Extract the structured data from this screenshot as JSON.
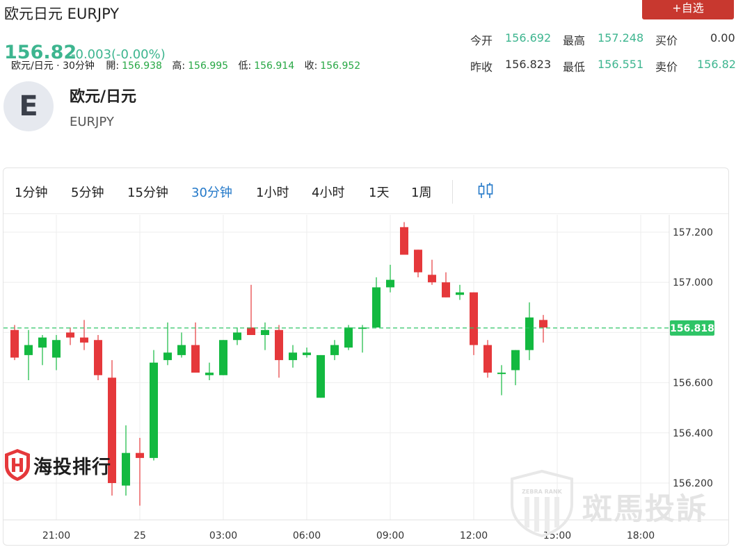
{
  "header": {
    "pair_title": "欧元日元 EURJPY",
    "add_watchlist": "+自选",
    "price": "156.82",
    "change": "-0.003(-0.00%)"
  },
  "quote": {
    "open_label": "今开",
    "open": "156.692",
    "high_label": "最高",
    "high": "157.248",
    "bid_label": "买价",
    "bid": "0.00",
    "prev_close_label": "昨收",
    "prev_close": "156.823",
    "low_label": "最低",
    "low": "156.551",
    "ask_label": "卖价",
    "ask": "156.82"
  },
  "profile": {
    "avatar_letter": "E",
    "name_cn": "欧元/日元",
    "name_en": "EURJPY"
  },
  "tabs": [
    {
      "label": "1分钟",
      "active": false
    },
    {
      "label": "5分钟",
      "active": false
    },
    {
      "label": "15分钟",
      "active": false
    },
    {
      "label": "30分钟",
      "active": true
    },
    {
      "label": "1小时",
      "active": false
    },
    {
      "label": "4小时",
      "active": false
    },
    {
      "label": "1天",
      "active": false
    },
    {
      "label": "1周",
      "active": false
    }
  ],
  "legend": {
    "series": "欧元/日元 · 30分钟",
    "open_label": "開:",
    "open": "156.938",
    "high_label": "高:",
    "high": "156.995",
    "low_label": "低:",
    "low": "156.914",
    "close_label": "收:",
    "close": "156.952"
  },
  "watermarks": {
    "haitou": "海投排行",
    "zebra": "斑馬投訴",
    "zebra_badge": "ZEBRA RANK"
  },
  "colors": {
    "up": "#13b940",
    "down": "#e5383b",
    "accent": "#2479c9",
    "price_line": "#2ec466",
    "brand_red": "#c8382f"
  },
  "chart_data": {
    "type": "candlestick",
    "ylim": [
      156.13,
      157.25
    ],
    "yticks": [
      "157.200",
      "157.000",
      "156.600",
      "156.400",
      "156.200"
    ],
    "xticks": [
      "21:00",
      "25",
      "03:00",
      "06:00",
      "09:00",
      "12:00",
      "15:00",
      "18:00"
    ],
    "last_price": "156.818",
    "candles": [
      {
        "o": 156.81,
        "h": 156.83,
        "l": 156.69,
        "c": 156.7
      },
      {
        "o": 156.71,
        "h": 156.81,
        "l": 156.61,
        "c": 156.75
      },
      {
        "o": 156.74,
        "h": 156.79,
        "l": 156.67,
        "c": 156.78
      },
      {
        "o": 156.7,
        "h": 156.79,
        "l": 156.65,
        "c": 156.77
      },
      {
        "o": 156.8,
        "h": 156.82,
        "l": 156.75,
        "c": 156.78
      },
      {
        "o": 156.78,
        "h": 156.85,
        "l": 156.73,
        "c": 156.76
      },
      {
        "o": 156.77,
        "h": 156.79,
        "l": 156.61,
        "c": 156.63
      },
      {
        "o": 156.62,
        "h": 156.69,
        "l": 156.15,
        "c": 156.2
      },
      {
        "o": 156.19,
        "h": 156.43,
        "l": 156.15,
        "c": 156.32
      },
      {
        "o": 156.32,
        "h": 156.38,
        "l": 156.11,
        "c": 156.3
      },
      {
        "o": 156.3,
        "h": 156.73,
        "l": 156.29,
        "c": 156.68
      },
      {
        "o": 156.69,
        "h": 156.84,
        "l": 156.67,
        "c": 156.72
      },
      {
        "o": 156.71,
        "h": 156.8,
        "l": 156.7,
        "c": 156.75
      },
      {
        "o": 156.75,
        "h": 156.84,
        "l": 156.66,
        "c": 156.64
      },
      {
        "o": 156.63,
        "h": 156.68,
        "l": 156.61,
        "c": 156.64
      },
      {
        "o": 156.63,
        "h": 156.77,
        "l": 156.63,
        "c": 156.77
      },
      {
        "o": 156.77,
        "h": 156.82,
        "l": 156.75,
        "c": 156.8
      },
      {
        "o": 156.82,
        "h": 156.99,
        "l": 156.79,
        "c": 156.79
      },
      {
        "o": 156.79,
        "h": 156.84,
        "l": 156.73,
        "c": 156.81
      },
      {
        "o": 156.81,
        "h": 156.83,
        "l": 156.62,
        "c": 156.69
      },
      {
        "o": 156.69,
        "h": 156.75,
        "l": 156.66,
        "c": 156.72
      },
      {
        "o": 156.71,
        "h": 156.74,
        "l": 156.7,
        "c": 156.72
      },
      {
        "o": 156.54,
        "h": 156.71,
        "l": 156.54,
        "c": 156.71
      },
      {
        "o": 156.71,
        "h": 156.77,
        "l": 156.69,
        "c": 156.75
      },
      {
        "o": 156.74,
        "h": 156.83,
        "l": 156.73,
        "c": 156.82
      },
      {
        "o": 156.82,
        "h": 156.83,
        "l": 156.72,
        "c": 156.82
      },
      {
        "o": 156.82,
        "h": 157.02,
        "l": 156.82,
        "c": 156.98
      },
      {
        "o": 156.98,
        "h": 157.07,
        "l": 156.96,
        "c": 157.01
      },
      {
        "o": 157.22,
        "h": 157.24,
        "l": 157.12,
        "c": 157.11
      },
      {
        "o": 157.13,
        "h": 157.13,
        "l": 157.02,
        "c": 157.04
      },
      {
        "o": 157.03,
        "h": 157.09,
        "l": 156.99,
        "c": 157.0
      },
      {
        "o": 157.0,
        "h": 157.04,
        "l": 156.94,
        "c": 156.94
      },
      {
        "o": 156.95,
        "h": 156.99,
        "l": 156.93,
        "c": 156.96
      },
      {
        "o": 156.96,
        "h": 156.96,
        "l": 156.71,
        "c": 156.75
      },
      {
        "o": 156.75,
        "h": 156.77,
        "l": 156.62,
        "c": 156.64
      },
      {
        "o": 156.64,
        "h": 156.67,
        "l": 156.55,
        "c": 156.64
      },
      {
        "o": 156.65,
        "h": 156.73,
        "l": 156.59,
        "c": 156.73
      },
      {
        "o": 156.73,
        "h": 156.92,
        "l": 156.69,
        "c": 156.86
      },
      {
        "o": 156.85,
        "h": 156.87,
        "l": 156.76,
        "c": 156.82
      }
    ]
  }
}
